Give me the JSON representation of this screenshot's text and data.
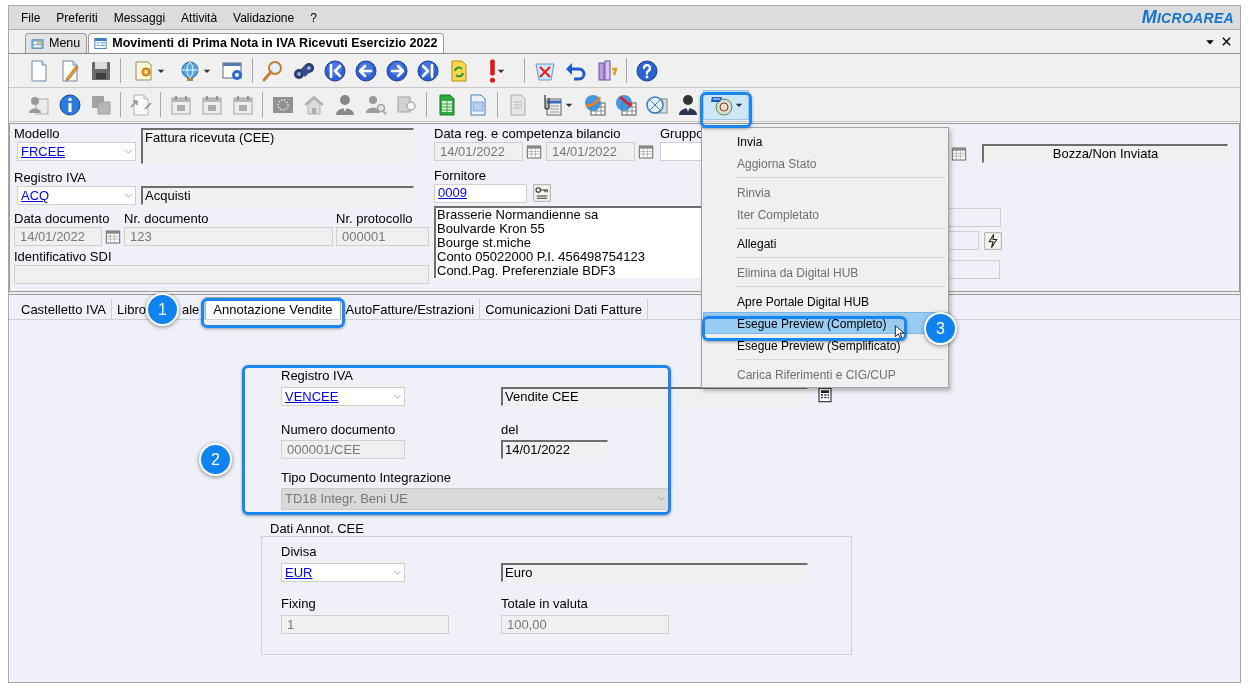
{
  "menu_bar": [
    {
      "label": "File"
    },
    {
      "label": "Preferiti"
    },
    {
      "label": "Messaggi"
    },
    {
      "label": "Attività"
    },
    {
      "label": "Validazione"
    },
    {
      "label": "?"
    }
  ],
  "logo": "MICROAREA",
  "doc_tabs": [
    {
      "label": "Menu",
      "selected": false
    },
    {
      "label": "Movimenti di Prima Nota in IVA Ricevuti Esercizio 2022",
      "selected": true
    }
  ],
  "toolbar_1": [
    {
      "kind": "button",
      "disabled": false,
      "menu": false,
      "pressed": false
    },
    {
      "kind": "button",
      "disabled": false,
      "menu": false,
      "pressed": false
    },
    {
      "kind": "button",
      "disabled": false,
      "menu": false,
      "pressed": false
    },
    {
      "kind": "separator"
    },
    {
      "kind": "button",
      "disabled": false,
      "menu": true,
      "pressed": false
    },
    {
      "kind": "button",
      "disabled": false,
      "menu": true,
      "pressed": false
    },
    {
      "kind": "button",
      "disabled": false,
      "menu": false,
      "pressed": false
    },
    {
      "kind": "separator"
    },
    {
      "kind": "button",
      "disabled": false,
      "menu": false,
      "pressed": false
    },
    {
      "kind": "button",
      "disabled": false,
      "menu": false,
      "pressed": false
    },
    {
      "kind": "button",
      "disabled": false,
      "menu": false,
      "pressed": false
    },
    {
      "kind": "button",
      "disabled": false,
      "menu": false,
      "pressed": false
    },
    {
      "kind": "button",
      "disabled": false,
      "menu": false,
      "pressed": false
    },
    {
      "kind": "button",
      "disabled": false,
      "menu": false,
      "pressed": false
    },
    {
      "kind": "button",
      "disabled": false,
      "menu": false,
      "pressed": false
    },
    {
      "kind": "button",
      "disabled": false,
      "menu": true,
      "pressed": false
    },
    {
      "kind": "separator"
    },
    {
      "kind": "button",
      "disabled": false,
      "menu": false,
      "pressed": false
    },
    {
      "kind": "button",
      "disabled": false,
      "menu": false,
      "pressed": false
    },
    {
      "kind": "button",
      "disabled": false,
      "menu": false,
      "pressed": false
    },
    {
      "kind": "separator"
    },
    {
      "kind": "button",
      "disabled": false,
      "menu": false,
      "pressed": false
    }
  ],
  "toolbar_2": [
    {
      "kind": "button",
      "disabled": true,
      "menu": false,
      "pressed": false
    },
    {
      "kind": "button",
      "disabled": false,
      "menu": false,
      "pressed": false
    },
    {
      "kind": "button",
      "disabled": true,
      "menu": false,
      "pressed": false
    },
    {
      "kind": "separator"
    },
    {
      "kind": "button",
      "disabled": true,
      "menu": false,
      "pressed": false
    },
    {
      "kind": "separator"
    },
    {
      "kind": "button",
      "disabled": true,
      "menu": false,
      "pressed": false
    },
    {
      "kind": "button",
      "disabled": true,
      "menu": false,
      "pressed": false
    },
    {
      "kind": "button",
      "disabled": true,
      "menu": false,
      "pressed": false
    },
    {
      "kind": "separator"
    },
    {
      "kind": "button",
      "disabled": true,
      "menu": false,
      "pressed": false
    },
    {
      "kind": "button",
      "disabled": true,
      "menu": false,
      "pressed": false
    },
    {
      "kind": "button",
      "disabled": true,
      "menu": false,
      "pressed": false
    },
    {
      "kind": "button",
      "disabled": true,
      "menu": false,
      "pressed": false
    },
    {
      "kind": "button",
      "disabled": true,
      "menu": false,
      "pressed": false
    },
    {
      "kind": "separator"
    },
    {
      "kind": "button",
      "disabled": false,
      "menu": false,
      "pressed": false
    },
    {
      "kind": "button",
      "disabled": false,
      "menu": false,
      "pressed": false
    },
    {
      "kind": "separator"
    },
    {
      "kind": "button",
      "disabled": true,
      "menu": false,
      "pressed": false
    },
    {
      "kind": "button",
      "disabled": false,
      "menu": true,
      "pressed": false
    },
    {
      "kind": "button",
      "disabled": false,
      "menu": false,
      "pressed": false
    },
    {
      "kind": "button",
      "disabled": false,
      "menu": false,
      "pressed": false
    },
    {
      "kind": "button",
      "disabled": false,
      "menu": false,
      "pressed": false
    },
    {
      "kind": "button",
      "disabled": false,
      "menu": false,
      "pressed": false
    },
    {
      "kind": "button",
      "disabled": false,
      "menu": true,
      "pressed": true
    }
  ],
  "header_form": {
    "modello": {
      "label": "Modello",
      "value": "FRCEE",
      "description": "Fattura ricevuta (CEE)"
    },
    "registro_iva": {
      "label": "Registro IVA",
      "value": "ACQ",
      "description": "Acquisti"
    },
    "data_documento": {
      "label": "Data documento",
      "value": "14/01/2022",
      "disabled": true
    },
    "nr_documento": {
      "label": "Nr. documento",
      "value": "123",
      "disabled": true
    },
    "nr_protocollo": {
      "label": "Nr. protocollo",
      "value": "000001",
      "disabled": true
    },
    "identificativo_sdi": {
      "label": "Identificativo SDI",
      "disabled": true
    },
    "data_reg": {
      "label": "Data reg. e competenza bilancio",
      "value": "14/01/2022",
      "value_2": "14/01/2022",
      "disabled": true
    },
    "gruppo": {
      "label": "Gruppo"
    },
    "fornitore": {
      "label": "Fornitore",
      "value": "0009",
      "address_lines": [
        "Brasserie Normandienne sa",
        "Boulvarde Kron 55",
        "Bourge st.miche",
        "Conto 05022000 P.I. 456498754123",
        "Cond.Pag. Preferenziale BDF3"
      ]
    },
    "status": "Bozza/Non Inviata"
  },
  "section_tabs": [
    {
      "label": "Castelletto IVA",
      "selected": false
    },
    {
      "label": "Libro",
      "label_end": "ale",
      "selected": false
    },
    {
      "label": "Annotazione Vendite",
      "selected": true
    },
    {
      "label": "AutoFatture/Estrazioni",
      "selected": false
    },
    {
      "label": "Comunicazioni Dati Fatture",
      "selected": false
    }
  ],
  "annotazione_vendite": {
    "registro_iva": {
      "label": "Registro IVA",
      "value": "VENCEE",
      "description": "Vendite CEE"
    },
    "numero_documento": {
      "label": "Numero documento",
      "value": "000001/CEE",
      "disabled": true
    },
    "del": {
      "label": "del",
      "value": "14/01/2022",
      "disabled": false
    },
    "tipo_documento": {
      "label": "Tipo Documento Integrazione",
      "value": "TD18 Integr. Beni UE",
      "disabled": true
    }
  },
  "dati_annot_cee": {
    "title": "Dati Annot. CEE",
    "divisa": {
      "label": "Divisa",
      "value": "EUR",
      "description": "Euro"
    },
    "fixing": {
      "label": "Fixing",
      "value": "1",
      "disabled": true
    },
    "totale": {
      "label": "Totale in valuta",
      "value": "100,00",
      "disabled": true
    }
  },
  "dropdown_menu": [
    {
      "kind": "item",
      "label": "Invia",
      "disabled": false,
      "selected": false
    },
    {
      "kind": "item",
      "label": "Aggiorna Stato",
      "disabled": true,
      "selected": false
    },
    {
      "kind": "separator"
    },
    {
      "kind": "item",
      "label": "Rinvia",
      "disabled": true,
      "selected": false
    },
    {
      "kind": "item",
      "label": "Iter Completato",
      "disabled": true,
      "selected": false
    },
    {
      "kind": "separator"
    },
    {
      "kind": "item",
      "label": "Allegati",
      "disabled": false,
      "selected": false
    },
    {
      "kind": "separator"
    },
    {
      "kind": "item",
      "label": "Elimina da Digital HUB",
      "disabled": true,
      "selected": false
    },
    {
      "kind": "separator"
    },
    {
      "kind": "item",
      "label": "Apre Portale Digital HUB",
      "disabled": false,
      "selected": false
    },
    {
      "kind": "item",
      "label": "Esegue Preview (Completo)",
      "disabled": false,
      "selected": true
    },
    {
      "kind": "item",
      "label": "Esegue Preview (Semplificato)",
      "disabled": false,
      "selected": false
    },
    {
      "kind": "separator"
    },
    {
      "kind": "item",
      "label": "Carica Riferimenti e CIG/CUP",
      "disabled": true,
      "selected": false
    }
  ],
  "annotations": [
    {
      "label": "1"
    },
    {
      "label": "2"
    },
    {
      "label": "3"
    }
  ]
}
